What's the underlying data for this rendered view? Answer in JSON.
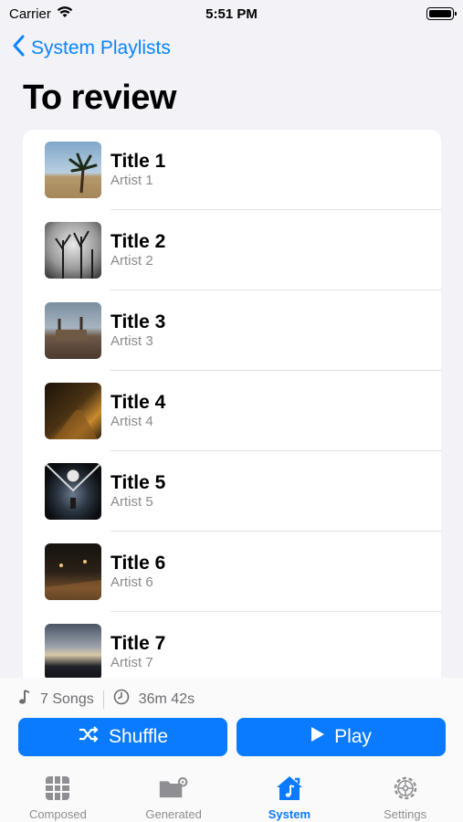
{
  "status": {
    "carrier": "Carrier",
    "time": "5:51 PM"
  },
  "nav": {
    "back_label": "System Playlists",
    "title": "To review"
  },
  "songs": [
    {
      "title": "Title 1",
      "artist": "Artist 1"
    },
    {
      "title": "Title 2",
      "artist": "Artist 2"
    },
    {
      "title": "Title 3",
      "artist": "Artist 3"
    },
    {
      "title": "Title 4",
      "artist": "Artist 4"
    },
    {
      "title": "Title 5",
      "artist": "Artist 5"
    },
    {
      "title": "Title 6",
      "artist": "Artist 6"
    },
    {
      "title": "Title 7",
      "artist": "Artist 7"
    }
  ],
  "summary": {
    "song_count": "7 Songs",
    "duration": "36m 42s"
  },
  "actions": {
    "shuffle_label": "Shuffle",
    "play_label": "Play"
  },
  "tabs": [
    {
      "label": "Composed",
      "icon": "grid-icon"
    },
    {
      "label": "Generated",
      "icon": "folder-gear-icon"
    },
    {
      "label": "System",
      "icon": "house-music-icon",
      "active": true
    },
    {
      "label": "Settings",
      "icon": "gear-icon"
    }
  ],
  "colors": {
    "accent": "#0a7aff",
    "background": "#f2f2f7"
  }
}
